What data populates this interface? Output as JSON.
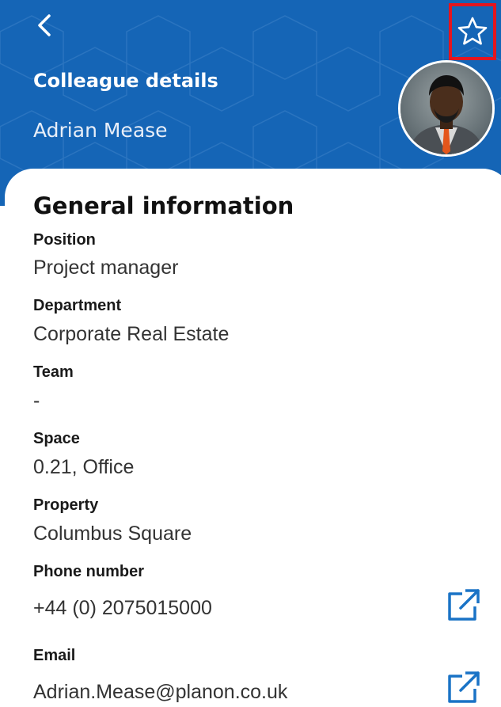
{
  "header": {
    "title": "Colleague details",
    "name": "Adrian Mease",
    "back_icon": "chevron-left-icon",
    "favorite_icon": "star-outline-icon",
    "background_color": "#1565b6",
    "highlight_color": "#e3161f"
  },
  "general": {
    "title": "General information",
    "fields": [
      {
        "label": "Position",
        "value": "Project manager"
      },
      {
        "label": "Department",
        "value": "Corporate Real Estate"
      },
      {
        "label": "Team",
        "value": "-"
      },
      {
        "label": "Space",
        "value": "0.21, Office"
      },
      {
        "label": "Property",
        "value": "Columbus Square"
      },
      {
        "label": "Phone number",
        "value": "+44 (0) 2075015000"
      },
      {
        "label": "Email",
        "value": "Adrian.Mease@planon.co.uk"
      }
    ],
    "link_icon": "external-link-icon",
    "link_color": "#1a73c6"
  }
}
